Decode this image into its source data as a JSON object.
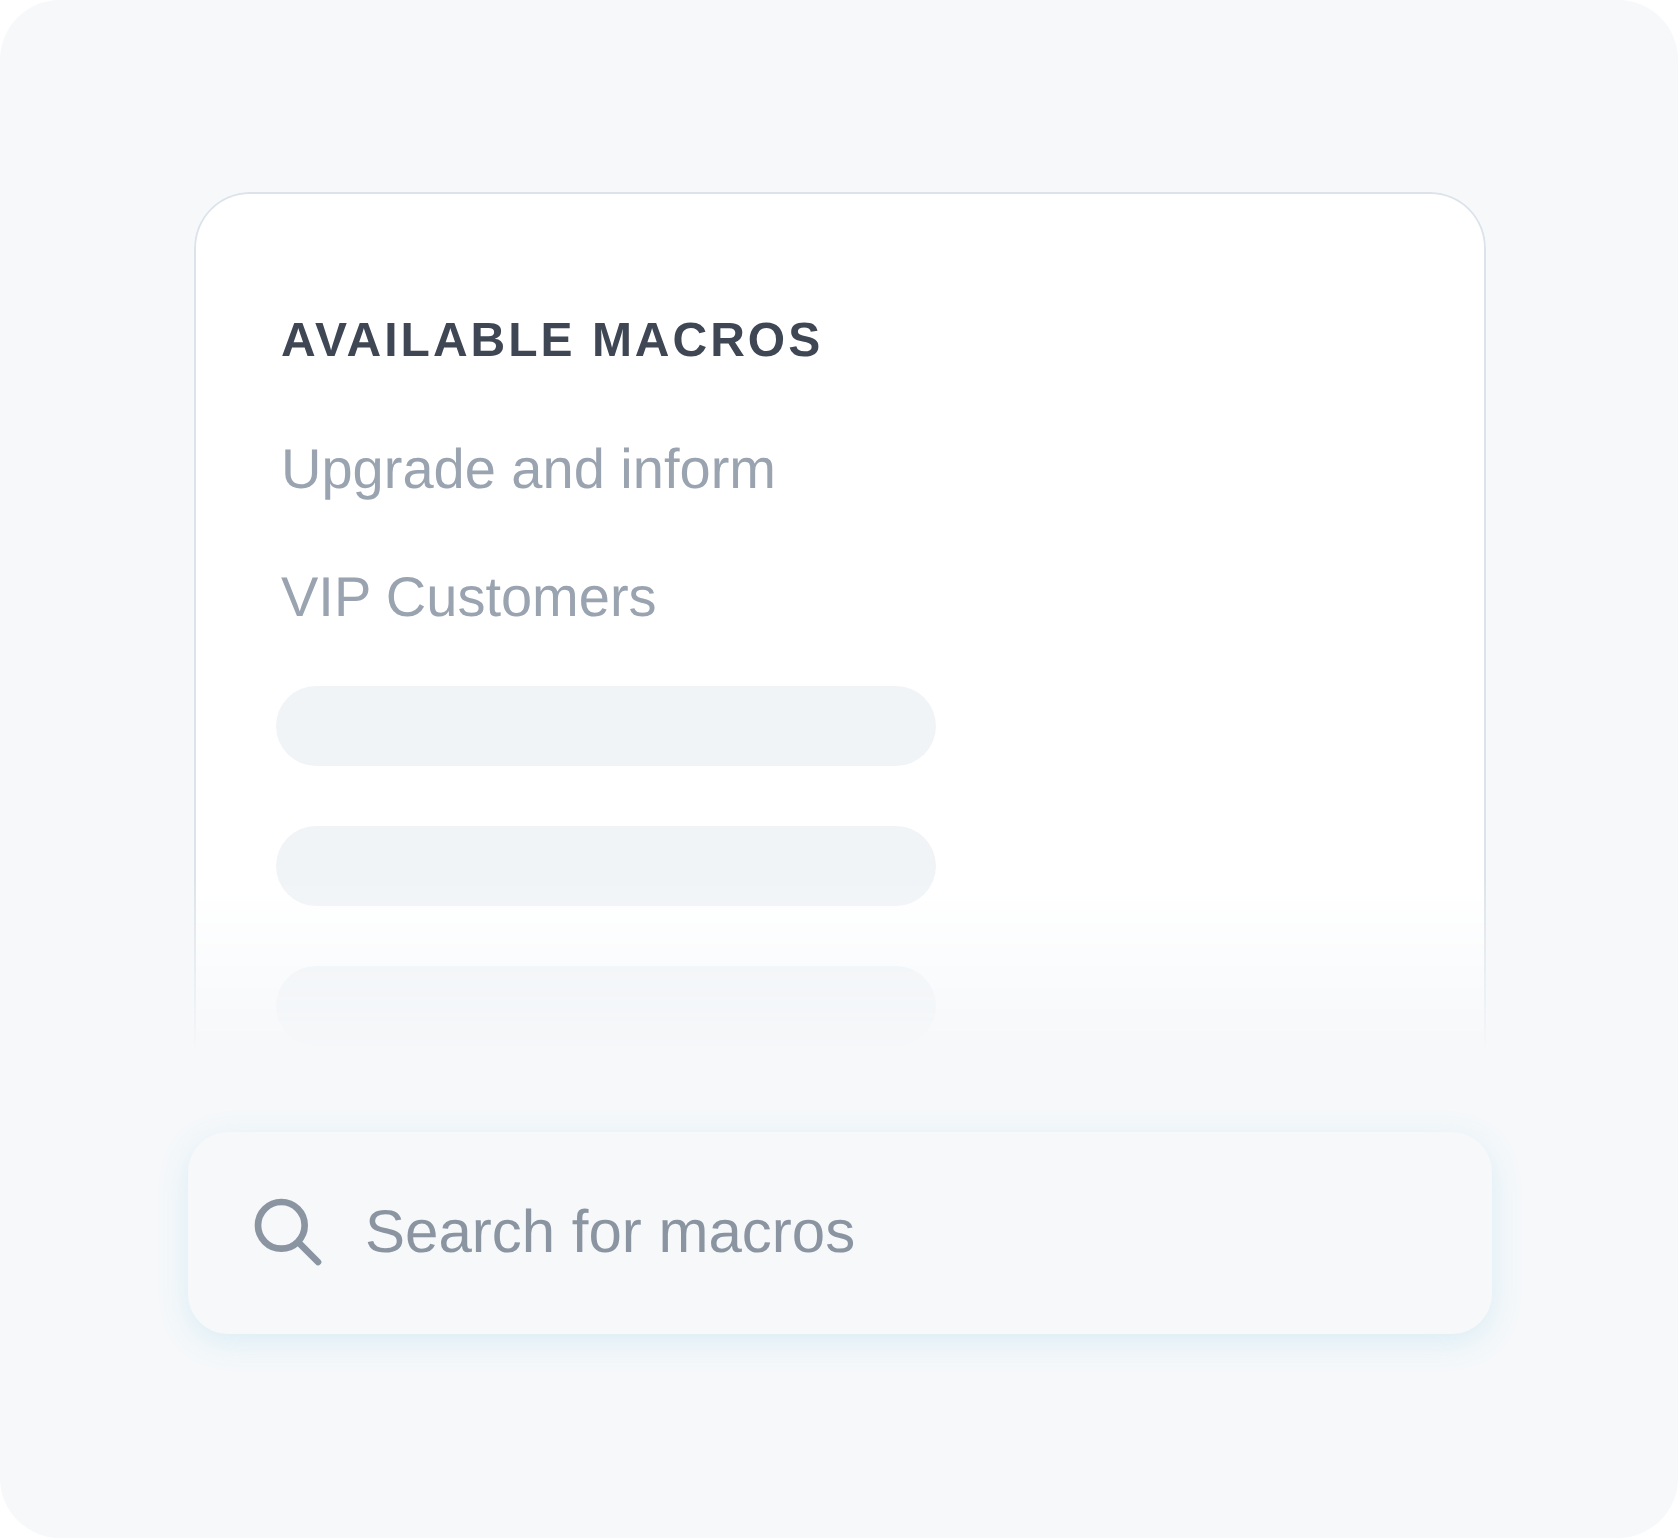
{
  "macros_panel": {
    "heading": "AVAILABLE MACROS",
    "items": [
      {
        "label": "Upgrade and inform"
      },
      {
        "label": "VIP Customers"
      }
    ]
  },
  "search": {
    "placeholder": "Search for macros"
  }
}
